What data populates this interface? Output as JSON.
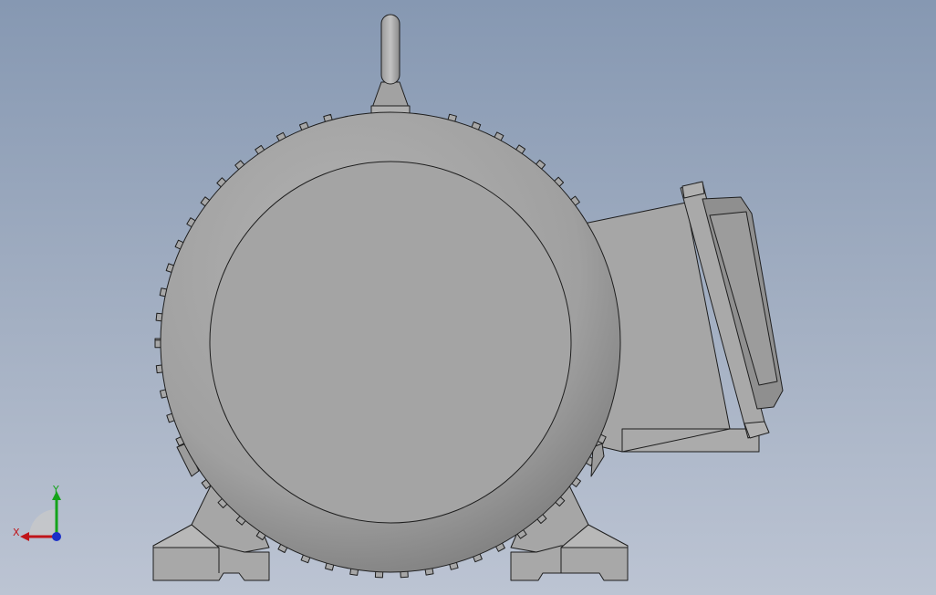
{
  "viewport": {
    "background_top": "#8698b2",
    "background_bottom": "#bcc4d3"
  },
  "model": {
    "body_color": "#a3a3a3",
    "shade_color": "#8d8d8d",
    "edge_color": "#1e1e1e",
    "parts": [
      "lifting-eye",
      "fan-cover",
      "cooling-fins",
      "mounting-feet",
      "terminal-box"
    ]
  },
  "triad": {
    "x_label": "X",
    "y_label": "Y",
    "x_color": "#c0151a",
    "y_color": "#14a31a",
    "z_color": "#1a2fc8"
  }
}
